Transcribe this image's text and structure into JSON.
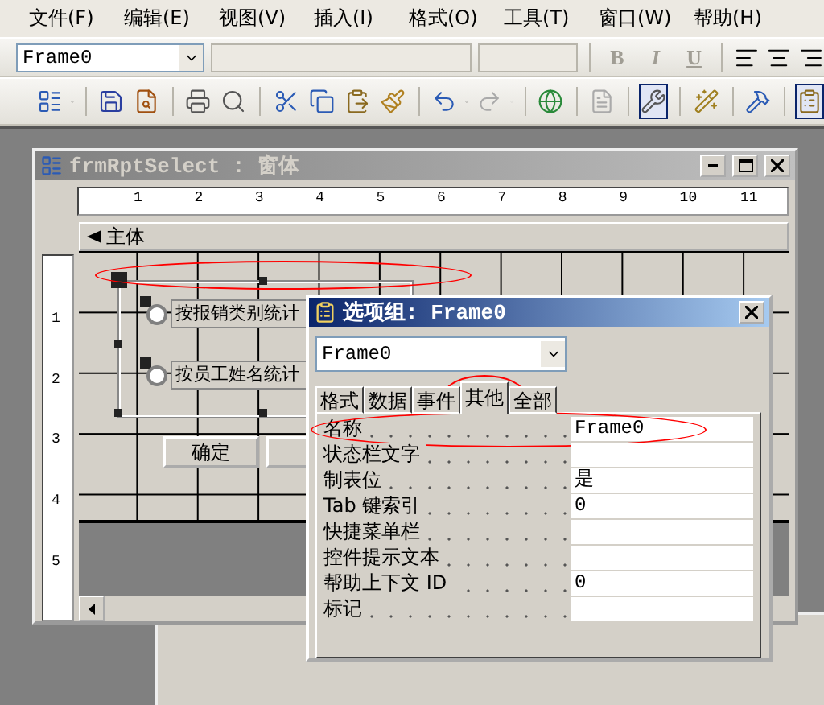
{
  "menu": [
    "文件(F)",
    "编辑(E)",
    "视图(V)",
    "插入(I)",
    "格式(O)",
    "工具(T)",
    "窗口(W)",
    "帮助(H)"
  ],
  "format_toolbar": {
    "object": "Frame0",
    "style_buttons": [
      "B",
      "I",
      "U"
    ]
  },
  "form_window": {
    "title": "frmRptSelect : 窗体",
    "ruler_numbers": [
      "1",
      "2",
      "3",
      "4",
      "5",
      "6",
      "7",
      "8",
      "9",
      "10",
      "11"
    ],
    "vertical_ruler_numbers": [
      "1",
      "2",
      "3",
      "4",
      "5"
    ],
    "section": "主体",
    "frame_circled": true,
    "options": [
      {
        "label": "按报销类别统计",
        "checked": false
      },
      {
        "label": "按员工姓名统计",
        "checked": false
      }
    ],
    "buttons": [
      "确定"
    ]
  },
  "property_sheet": {
    "title": "选项组: Frame0",
    "object": "Frame0",
    "tabs": [
      {
        "label": "格式",
        "selected": false,
        "circled": false
      },
      {
        "label": "数据",
        "selected": false,
        "circled": false
      },
      {
        "label": "事件",
        "selected": false,
        "circled": false
      },
      {
        "label": "其他",
        "selected": true,
        "circled": true
      },
      {
        "label": "全部",
        "selected": false,
        "circled": false
      }
    ],
    "properties": [
      {
        "name": "名称",
        "value": "Frame0",
        "circled": true
      },
      {
        "name": "状态栏文字",
        "circled": false
      },
      {
        "name": "制表位",
        "value": "是",
        "circled": false
      },
      {
        "name": "Tab 键索引",
        "value": "0",
        "circled": false
      },
      {
        "name": "快捷菜单栏",
        "circled": false
      },
      {
        "name": "控件提示文本",
        "circled": false
      },
      {
        "name": "帮助上下文 ID",
        "value": "0",
        "circled": false
      },
      {
        "name": "标记",
        "circled": false
      }
    ]
  }
}
